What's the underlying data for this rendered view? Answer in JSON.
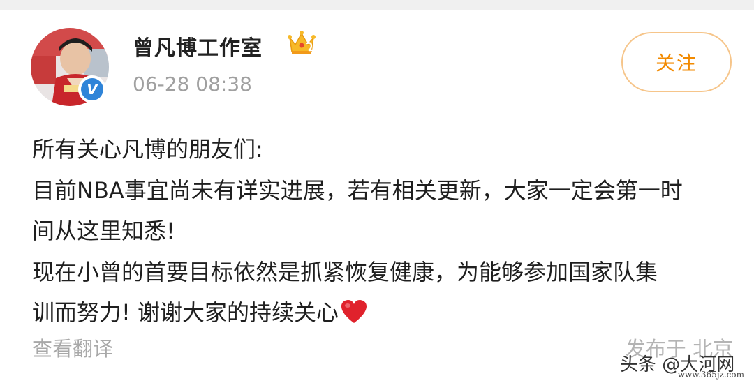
{
  "header": {
    "user_name": "曾凡博工作室",
    "time": "06-28 08:38",
    "follow_label": "关注",
    "verified_mark": "V",
    "crown_badge": "crown-level-icon"
  },
  "post": {
    "lines": [
      "所有关心凡博的朋友们:",
      "目前NBA事宜尚未有详实进展，若有相关更新，大家一定会第一时",
      "间从这里知悉!",
      "现在小曾的首要目标依然是抓紧恢复健康，为能够参加国家队集",
      "训而努力! 谢谢大家的持续关心"
    ],
    "emoji": "heart-icon"
  },
  "footer": {
    "translate_label": "查看翻译",
    "location_label": "发布于 北京"
  },
  "watermark": {
    "text": "头条 @大河网",
    "url": "www.365jz.com"
  },
  "colors": {
    "accent": "#f28a00",
    "follow_border": "#f6c58a",
    "verified": "#2f84d8",
    "heart": "#e0222c",
    "muted_text": "#a0a0a0",
    "body_text": "#1f1f1f"
  }
}
